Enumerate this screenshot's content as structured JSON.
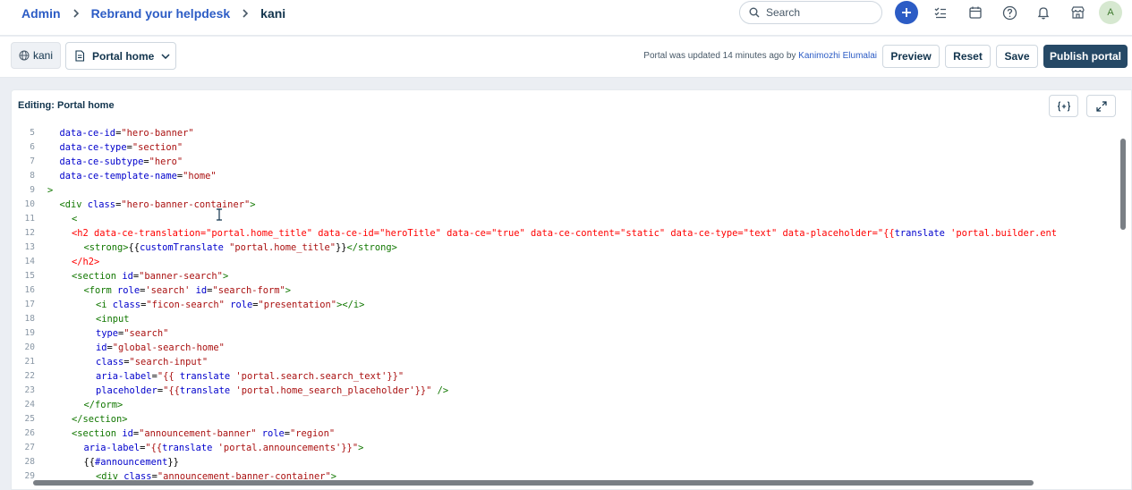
{
  "breadcrumb": {
    "admin": "Admin",
    "rebrand": "Rebrand your helpdesk",
    "current": "kani"
  },
  "search": {
    "placeholder": "Search"
  },
  "user": {
    "avatar_initial": "A"
  },
  "toolbar": {
    "portal_chip": "kani",
    "page_select": "Portal home",
    "updated_prefix": "Portal was updated 14 minutes ago by",
    "updated_by": "Kanimozhi Elumalai",
    "preview": "Preview",
    "reset": "Reset",
    "save": "Save",
    "publish": "Publish portal"
  },
  "editor": {
    "title": "Editing: Portal home",
    "lines": [
      {
        "n": "5",
        "indent": 1,
        "tokens": [
          [
            "attr",
            "data-ce-id"
          ],
          [
            "txt",
            "="
          ],
          [
            "str",
            "\"hero-banner\""
          ]
        ]
      },
      {
        "n": "6",
        "indent": 1,
        "tokens": [
          [
            "attr",
            "data-ce-type"
          ],
          [
            "txt",
            "="
          ],
          [
            "str",
            "\"section\""
          ]
        ]
      },
      {
        "n": "7",
        "indent": 1,
        "tokens": [
          [
            "attr",
            "data-ce-subtype"
          ],
          [
            "txt",
            "="
          ],
          [
            "str",
            "\"hero\""
          ]
        ]
      },
      {
        "n": "8",
        "indent": 1,
        "tokens": [
          [
            "attr",
            "data-ce-template-name"
          ],
          [
            "txt",
            "="
          ],
          [
            "str",
            "\"home\""
          ]
        ]
      },
      {
        "n": "9",
        "indent": 0,
        "tokens": [
          [
            "tag",
            ">"
          ]
        ]
      },
      {
        "n": "10",
        "indent": 1,
        "tokens": [
          [
            "tag",
            "<div "
          ],
          [
            "attr",
            "class"
          ],
          [
            "txt",
            "="
          ],
          [
            "str",
            "\"hero-banner-container\""
          ],
          [
            "tag",
            ">"
          ]
        ]
      },
      {
        "n": "11",
        "indent": 2,
        "tokens": [
          [
            "tag",
            "<"
          ]
        ]
      },
      {
        "n": "12",
        "indent": 2,
        "tokens": [
          [
            "err",
            "<h2 data-ce-translation=\"portal.home_title\" data-ce-id=\"heroTitle\" data-ce=\"true\" data-ce-content=\"static\" data-ce-type=\"text\" data-placeholder=\"{{"
          ],
          [
            "attr",
            "translate"
          ],
          [
            "err",
            " 'portal.builder.ent"
          ]
        ]
      },
      {
        "n": "13",
        "indent": 3,
        "tokens": [
          [
            "tag",
            "<strong>"
          ],
          [
            "txt",
            "{{"
          ],
          [
            "attr",
            "customTranslate"
          ],
          [
            "txt",
            " "
          ],
          [
            "str",
            "\"portal.home_title\""
          ],
          [
            "txt",
            "}}"
          ],
          [
            "tag",
            "</strong>"
          ]
        ]
      },
      {
        "n": "14",
        "indent": 2,
        "tokens": [
          [
            "err",
            "</h2>"
          ]
        ]
      },
      {
        "n": "15",
        "indent": 2,
        "tokens": [
          [
            "tag",
            "<section "
          ],
          [
            "attr",
            "id"
          ],
          [
            "txt",
            "="
          ],
          [
            "str",
            "\"banner-search\""
          ],
          [
            "tag",
            ">"
          ]
        ]
      },
      {
        "n": "16",
        "indent": 3,
        "tokens": [
          [
            "tag",
            "<form "
          ],
          [
            "attr",
            "role"
          ],
          [
            "txt",
            "="
          ],
          [
            "str",
            "'search'"
          ],
          [
            "txt",
            " "
          ],
          [
            "attr",
            "id"
          ],
          [
            "txt",
            "="
          ],
          [
            "str",
            "\"search-form\""
          ],
          [
            "tag",
            ">"
          ]
        ]
      },
      {
        "n": "17",
        "indent": 4,
        "tokens": [
          [
            "tag",
            "<i "
          ],
          [
            "attr",
            "class"
          ],
          [
            "txt",
            "="
          ],
          [
            "str",
            "\"ficon-search\""
          ],
          [
            "txt",
            " "
          ],
          [
            "attr",
            "role"
          ],
          [
            "txt",
            "="
          ],
          [
            "str",
            "\"presentation\""
          ],
          [
            "tag",
            "></i>"
          ]
        ]
      },
      {
        "n": "18",
        "indent": 4,
        "tokens": [
          [
            "tag",
            "<input"
          ]
        ]
      },
      {
        "n": "19",
        "indent": 4,
        "tokens": [
          [
            "attr",
            "type"
          ],
          [
            "txt",
            "="
          ],
          [
            "str",
            "\"search\""
          ]
        ]
      },
      {
        "n": "20",
        "indent": 4,
        "tokens": [
          [
            "attr",
            "id"
          ],
          [
            "txt",
            "="
          ],
          [
            "str",
            "\"global-search-home\""
          ]
        ]
      },
      {
        "n": "21",
        "indent": 4,
        "tokens": [
          [
            "attr",
            "class"
          ],
          [
            "txt",
            "="
          ],
          [
            "str",
            "\"search-input\""
          ]
        ]
      },
      {
        "n": "22",
        "indent": 4,
        "tokens": [
          [
            "attr",
            "aria-label"
          ],
          [
            "txt",
            "="
          ],
          [
            "str",
            "\"{{ "
          ],
          [
            "attr",
            "translate"
          ],
          [
            "str",
            " 'portal.search.search_text'}}\""
          ]
        ]
      },
      {
        "n": "23",
        "indent": 4,
        "tokens": [
          [
            "attr",
            "placeholder"
          ],
          [
            "txt",
            "="
          ],
          [
            "str",
            "\"{{"
          ],
          [
            "attr",
            "translate"
          ],
          [
            "str",
            " 'portal.home_search_placeholder'}}\""
          ],
          [
            "txt",
            " "
          ],
          [
            "tag",
            "/>"
          ]
        ]
      },
      {
        "n": "24",
        "indent": 3,
        "tokens": [
          [
            "tag",
            "</form>"
          ]
        ]
      },
      {
        "n": "25",
        "indent": 2,
        "tokens": [
          [
            "tag",
            "</section>"
          ]
        ]
      },
      {
        "n": "26",
        "indent": 2,
        "tokens": [
          [
            "tag",
            "<section "
          ],
          [
            "attr",
            "id"
          ],
          [
            "txt",
            "="
          ],
          [
            "str",
            "\"announcement-banner\""
          ],
          [
            "txt",
            " "
          ],
          [
            "attr",
            "role"
          ],
          [
            "txt",
            "="
          ],
          [
            "str",
            "\"region\""
          ]
        ]
      },
      {
        "n": "27",
        "indent": 3,
        "tokens": [
          [
            "attr",
            "aria-label"
          ],
          [
            "txt",
            "="
          ],
          [
            "str",
            "\"{{"
          ],
          [
            "attr",
            "translate"
          ],
          [
            "str",
            " 'portal.announcements'}}\""
          ],
          [
            "tag",
            ">"
          ]
        ]
      },
      {
        "n": "28",
        "indent": 3,
        "tokens": [
          [
            "txt",
            "{{"
          ],
          [
            "attr",
            "#announcement"
          ],
          [
            "txt",
            "}}"
          ]
        ]
      },
      {
        "n": "29",
        "indent": 4,
        "tokens": [
          [
            "tag",
            "<div "
          ],
          [
            "attr",
            "class"
          ],
          [
            "txt",
            "="
          ],
          [
            "str",
            "\"announcement-banner-container\""
          ],
          [
            "tag",
            ">"
          ]
        ]
      }
    ]
  }
}
